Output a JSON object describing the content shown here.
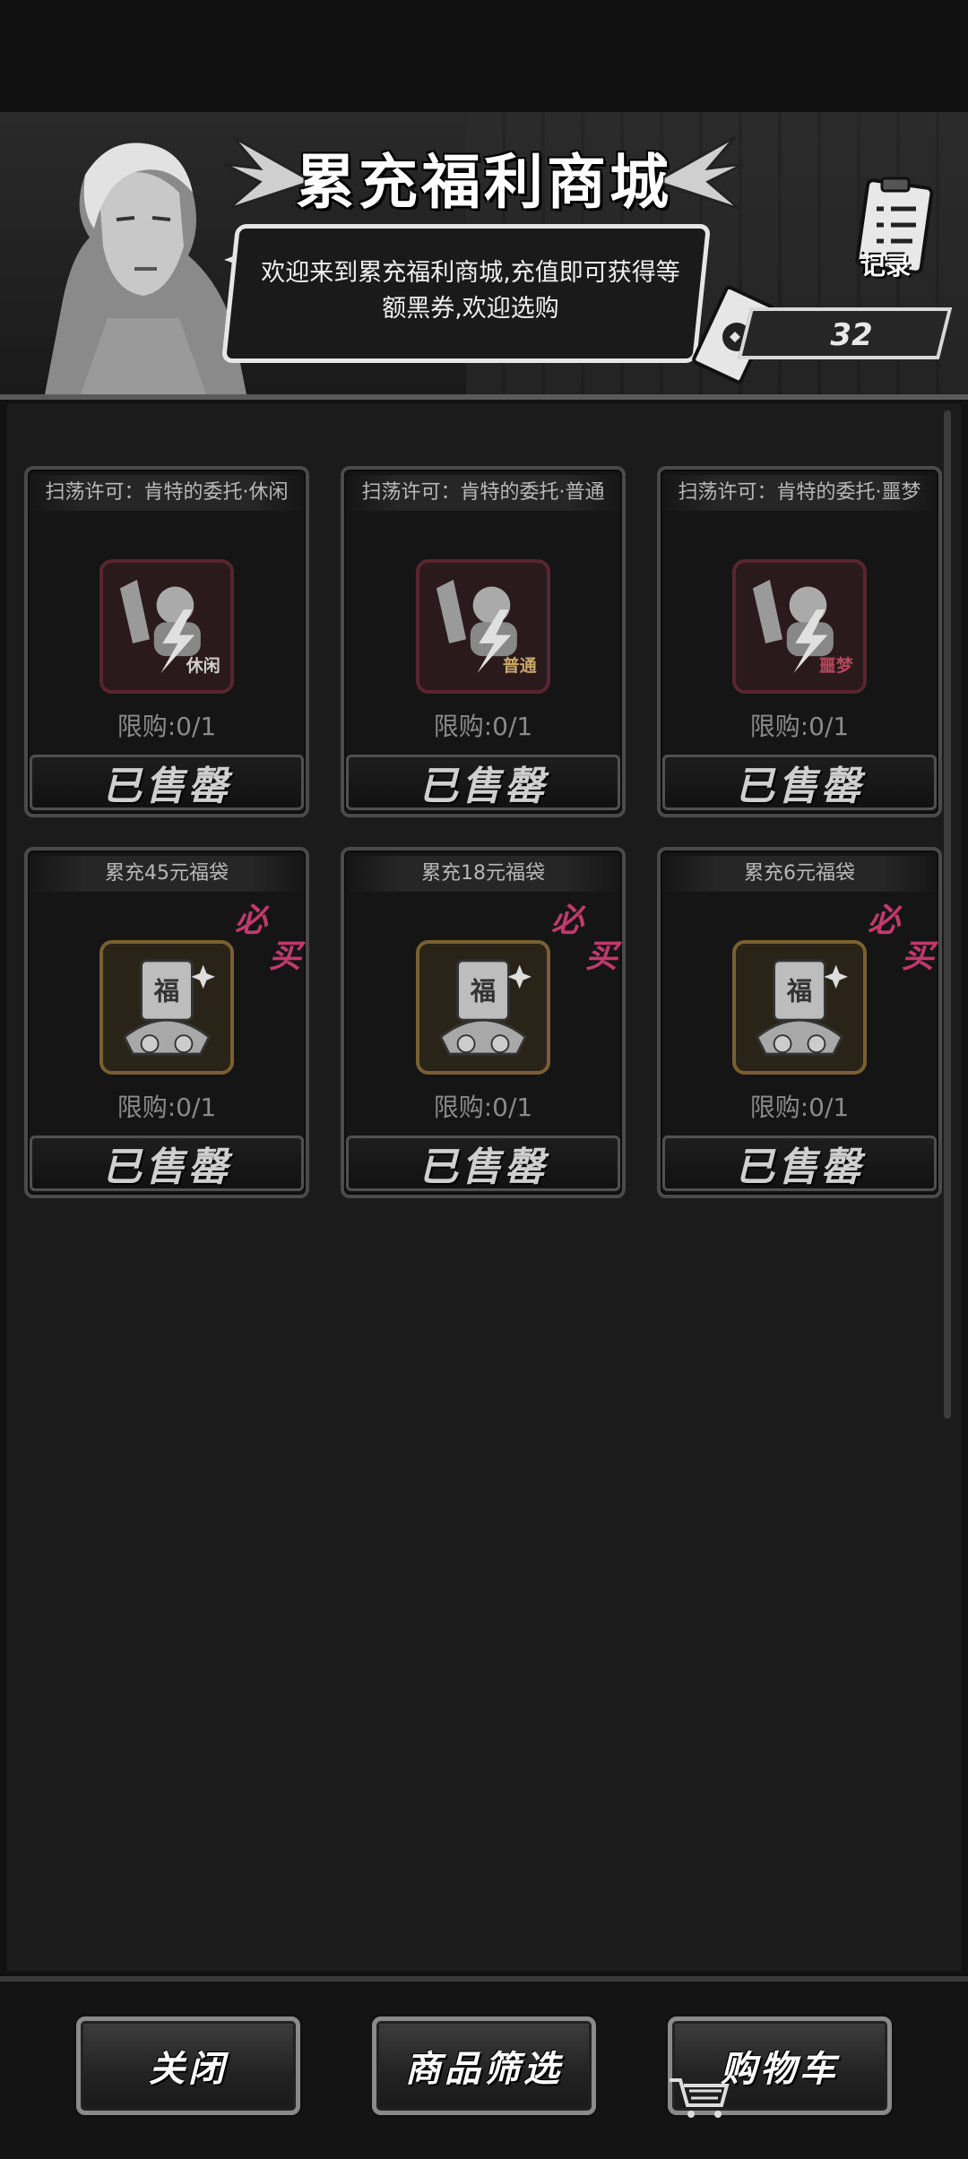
{
  "header": {
    "title": "累充福利商城",
    "welcome": "欢迎来到累充福利商城,充值即可获得等额黑券,欢迎选购",
    "record_label": "记录",
    "ticket_count": "32"
  },
  "items": [
    {
      "title": "扫荡许可：肯特的委托·休闲",
      "badge": "休闲",
      "limit": "限购:0/1",
      "button": "已售罄",
      "must_buy": ""
    },
    {
      "title": "扫荡许可：肯特的委托·普通",
      "badge": "普通",
      "limit": "限购:0/1",
      "button": "已售罄",
      "must_buy": ""
    },
    {
      "title": "扫荡许可：肯特的委托·噩梦",
      "badge": "噩梦",
      "limit": "限购:0/1",
      "button": "已售罄",
      "must_buy": ""
    },
    {
      "title": "累充45元福袋",
      "badge": "福",
      "limit": "限购:0/1",
      "button": "已售罄",
      "must_buy": "必买"
    },
    {
      "title": "累充18元福袋",
      "badge": "福",
      "limit": "限购:0/1",
      "button": "已售罄",
      "must_buy": "必买"
    },
    {
      "title": "累充6元福袋",
      "badge": "福",
      "limit": "限购:0/1",
      "button": "已售罄",
      "must_buy": "必买"
    }
  ],
  "footer": {
    "close": "关闭",
    "filter": "商品筛选",
    "cart": "购物车"
  },
  "colors": {
    "background": "#111111",
    "panel": "#1b1b1b",
    "must_buy": "#c03a6a",
    "sweep_icon_border": "#5a2530",
    "bag_icon_border": "#7a6030"
  }
}
